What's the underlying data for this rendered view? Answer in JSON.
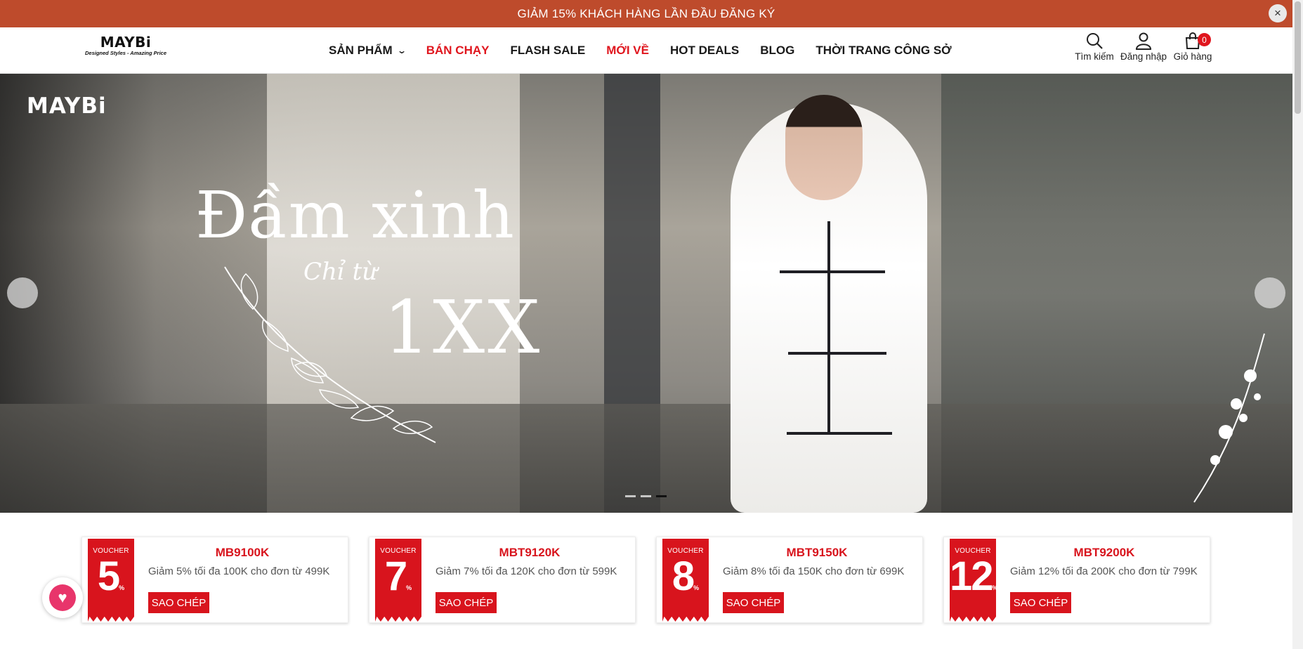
{
  "promo": {
    "text": "GIẢM 15% KHÁCH HÀNG LẦN ĐẦU ĐĂNG KÝ",
    "close_icon": "×"
  },
  "header": {
    "logo": {
      "main": "MAYBi",
      "sub": "Designed Styles - Amazing Price"
    },
    "nav": [
      {
        "label": "SẢN PHẨM",
        "has_dropdown": true,
        "color": "#1a1a1a"
      },
      {
        "label": "BÁN CHẠY",
        "color": "#e0161e"
      },
      {
        "label": "FLASH SALE",
        "color": "#1a1a1a"
      },
      {
        "label": "MỚI VỀ",
        "color": "#e0161e"
      },
      {
        "label": "HOT DEALS",
        "color": "#1a1a1a"
      },
      {
        "label": "BLOG",
        "color": "#1a1a1a"
      },
      {
        "label": "THỜI TRANG CÔNG SỞ",
        "color": "#1a1a1a"
      }
    ],
    "tools": {
      "search": "Tìm kiếm",
      "login": "Đăng nhập",
      "cart": "Giỏ hàng",
      "cart_count": "0"
    }
  },
  "hero": {
    "logo": "MAYBi",
    "title": "Đầm xinh",
    "subtitle": "Chỉ từ",
    "price": "1XX",
    "slide_count": 3,
    "active_slide": 3
  },
  "vouchers": [
    {
      "label": "VOUCHER",
      "number": "5",
      "unit": "%",
      "code": "MB9100K",
      "desc": "Giảm 5% tối đa 100K cho đơn từ 499K",
      "button": "SAO CHÉP"
    },
    {
      "label": "VOUCHER",
      "number": "7",
      "unit": "%",
      "code": "MBT9120K",
      "desc": "Giảm 7% tối đa 120K cho đơn từ 599K",
      "button": "SAO CHÉP"
    },
    {
      "label": "VOUCHER",
      "number": "8",
      "unit": "%",
      "code": "MBT9150K",
      "desc": "Giảm 8% tối đa 150K cho đơn từ 699K",
      "button": "SAO CHÉP"
    },
    {
      "label": "VOUCHER",
      "number": "12",
      "unit": "%",
      "code": "MBT9200K",
      "desc": "Giảm 12% tối đa 200K cho đơn từ 799K",
      "button": "SAO CHÉP"
    }
  ],
  "colors": {
    "promo_bg": "#be4b2c",
    "accent_red": "#d8141d",
    "heart": "#e8356b"
  }
}
